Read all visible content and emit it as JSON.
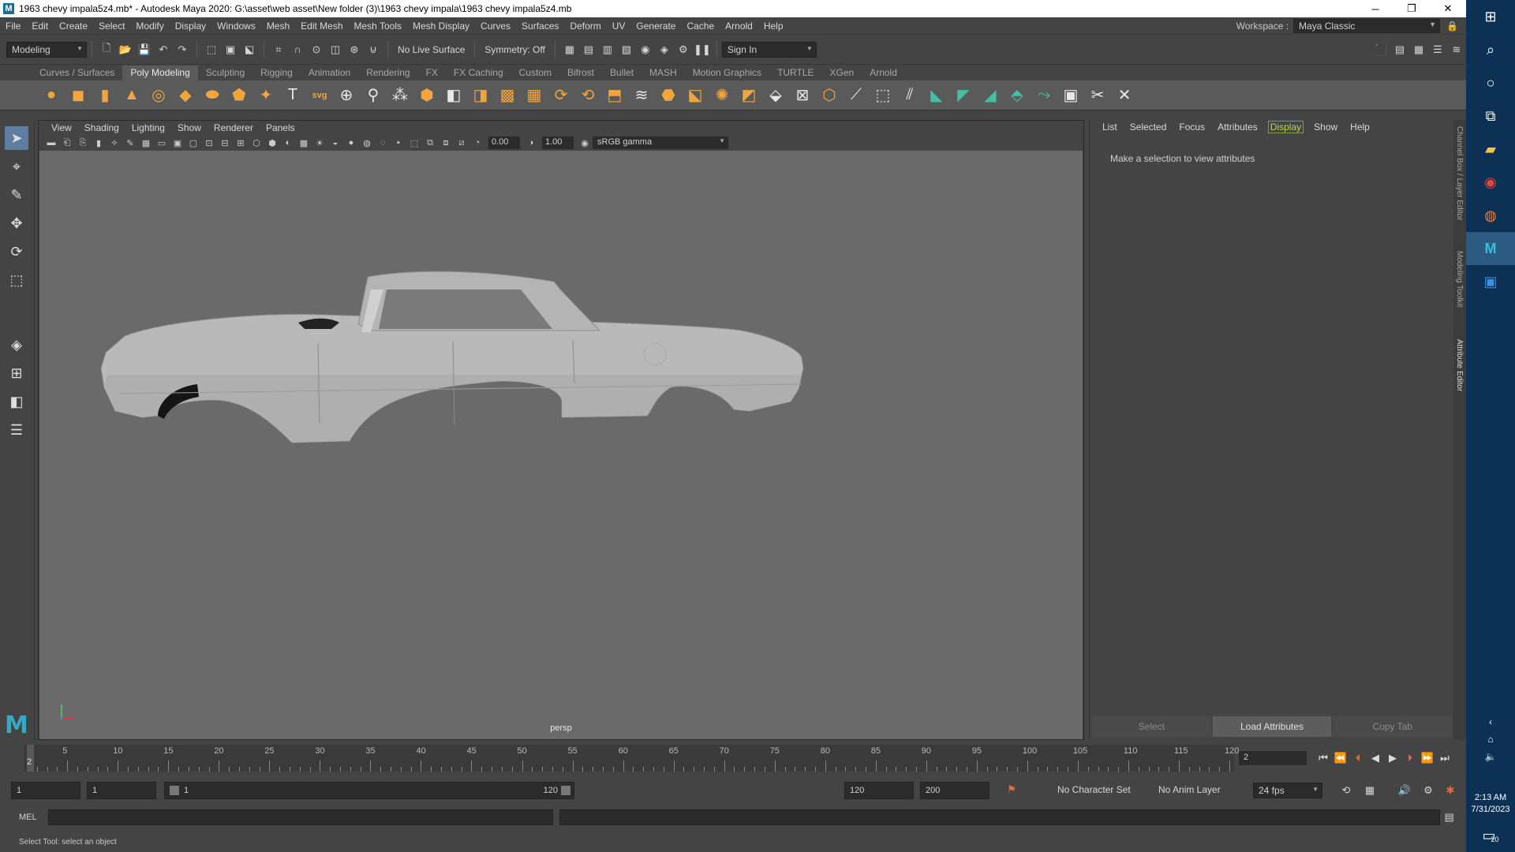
{
  "window": {
    "title": "1963 chevy impala5z4.mb* - Autodesk Maya 2020: G:\\asset\\web asset\\New folder (3)\\1963 chevy impala\\1963 chevy impala5z4.mb",
    "app_icon": "M",
    "minimize_icon": "─",
    "restore_icon": "❐",
    "close_icon": "✕"
  },
  "menubar": {
    "items": [
      "File",
      "Edit",
      "Create",
      "Select",
      "Modify",
      "Display",
      "Windows",
      "Mesh",
      "Edit Mesh",
      "Mesh Tools",
      "Mesh Display",
      "Curves",
      "Surfaces",
      "Deform",
      "UV",
      "Generate",
      "Cache",
      "Arnold",
      "Help"
    ],
    "workspace_label": "Workspace :",
    "workspace_value": "Maya Classic"
  },
  "statusline": {
    "mode": "Modeling",
    "live_surface": "No Live Surface",
    "symmetry": "Symmetry: Off",
    "sign_in": "Sign In"
  },
  "shelf": {
    "tabs": [
      "Curves / Surfaces",
      "Poly Modeling",
      "Sculpting",
      "Rigging",
      "Animation",
      "Rendering",
      "FX",
      "FX Caching",
      "Custom",
      "Bifrost",
      "Bullet",
      "MASH",
      "Motion Graphics",
      "TURTLE",
      "XGen",
      "Arnold"
    ],
    "active_tab": "Poly Modeling"
  },
  "viewport": {
    "menus": [
      "View",
      "Shading",
      "Lighting",
      "Show",
      "Renderer",
      "Panels"
    ],
    "exposure": "0.00",
    "gamma": "1.00",
    "color_space": "sRGB gamma",
    "camera": "persp"
  },
  "attribute_editor": {
    "menus": [
      "List",
      "Selected",
      "Focus",
      "Attributes",
      "Display",
      "Show",
      "Help"
    ],
    "message": "Make a selection to view attributes",
    "buttons": [
      "Select",
      "Load Attributes",
      "Copy Tab"
    ]
  },
  "side_tabs": [
    "Channel Box / Layer Editor",
    "Modeling Toolkit",
    "Attribute Editor"
  ],
  "time_slider": {
    "tick_labels": [
      "5",
      "10",
      "15",
      "20",
      "25",
      "30",
      "35",
      "40",
      "45",
      "50",
      "55",
      "60",
      "65",
      "70",
      "75",
      "80",
      "85",
      "90",
      "95",
      "100",
      "105",
      "110",
      "115",
      "120"
    ],
    "playhead_label": "2",
    "current_frame": "2"
  },
  "range_slider": {
    "start_time": "1",
    "playback_start": "1",
    "range_start_label": "1",
    "range_end_label": "120",
    "playback_end": "120",
    "end_time": "200",
    "character_set": "No Character Set",
    "anim_layer": "No Anim Layer",
    "fps": "24 fps"
  },
  "command_line": {
    "language": "MEL"
  },
  "help_line": "Select Tool: select an object",
  "taskbar": {
    "time": "2:13 AM",
    "date": "7/31/2023",
    "notification_count": "20"
  }
}
